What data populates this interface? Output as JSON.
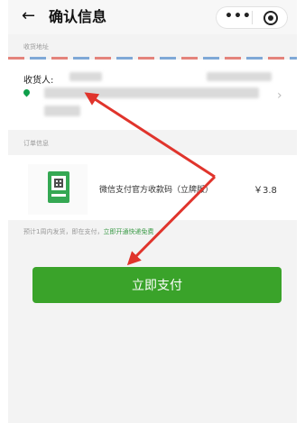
{
  "nav": {
    "back_icon": "←",
    "title": "确认信息",
    "menu_icon": "•••"
  },
  "address_section": {
    "label": "收货地址",
    "recipient_label": "收货人:",
    "chevron": "›"
  },
  "order_section": {
    "label": "订单信息",
    "item": {
      "name": "微信支付官方收款码（立牌版）",
      "price": "￥3.8"
    }
  },
  "delivery_note": {
    "text": "预计1周内发货，即在支付，",
    "link": "立即开通快递免费"
  },
  "pay_button": {
    "label": "立即支付"
  },
  "colors": {
    "accent": "#3aa32a",
    "annotation_arrow": "#e0342c"
  }
}
